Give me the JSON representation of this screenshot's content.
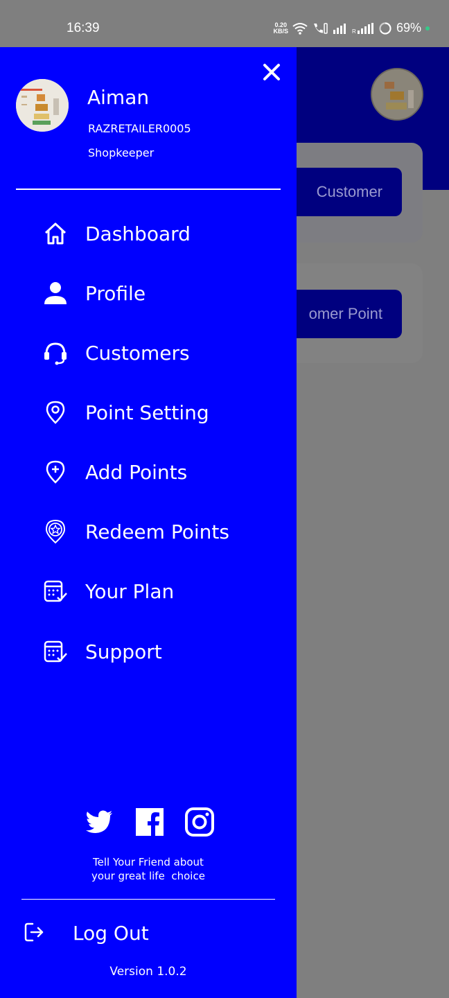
{
  "status_bar": {
    "time": "16:39",
    "speed_value": "0.20",
    "speed_unit": "KB/S",
    "battery": "69%",
    "icons": [
      "wifi-icon",
      "call-icon",
      "signal-icon",
      "signal-r-icon",
      "battery-icon"
    ]
  },
  "background": {
    "button1": "Customer",
    "button2": "omer Point"
  },
  "drawer": {
    "user": {
      "name": "Aiman",
      "id": "RAZRETAILER0005",
      "role": "Shopkeeper"
    },
    "menu": [
      {
        "label": "Dashboard",
        "icon": "home-icon"
      },
      {
        "label": "Profile",
        "icon": "person-icon"
      },
      {
        "label": "Customers",
        "icon": "headset-icon"
      },
      {
        "label": "Point Setting",
        "icon": "location-pin-icon"
      },
      {
        "label": "Add Points",
        "icon": "add-pin-icon"
      },
      {
        "label": "Redeem Points",
        "icon": "star-badge-icon"
      },
      {
        "label": "Your Plan",
        "icon": "calendar-check-icon"
      },
      {
        "label": "Support",
        "icon": "calendar-check-icon"
      }
    ],
    "social": [
      "twitter-icon",
      "facebook-icon",
      "instagram-icon"
    ],
    "tagline_line1": "Tell Your Friend about",
    "tagline_line2": "your great life  choice",
    "logout_label": "Log Out",
    "version": "Version 1.0.2"
  },
  "colors": {
    "drawer": "#0000ff",
    "scrim": "#7f7f7f",
    "bg_header": "#00007f"
  }
}
